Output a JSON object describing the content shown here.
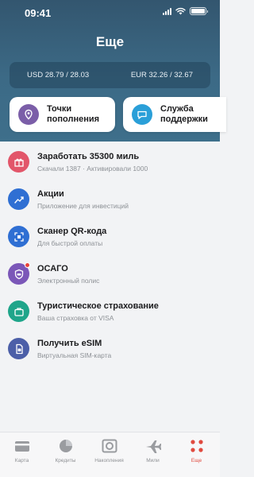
{
  "status_bar": {
    "time": "09:41"
  },
  "header": {
    "title": "Еще"
  },
  "rates": {
    "usd": "USD 28.79 / 28.03",
    "eur": "EUR 32.26 / 32.67"
  },
  "cards": [
    {
      "label": "Точки\nпополнения",
      "icon": "map-pin-icon",
      "color": "#7b5ea8"
    },
    {
      "label": "Служба\nподдержки",
      "icon": "chat-bubble-icon",
      "color": "#2a9fd8"
    }
  ],
  "menu": [
    {
      "title": "Заработать 35300 миль",
      "subtitle": "Скачали 1387 · Активировали 1000",
      "icon": "gift-icon",
      "color": "#e2566a"
    },
    {
      "title": "Акции",
      "subtitle": "Приложение для инвестиций",
      "icon": "chart-icon",
      "color": "#2f6fd3"
    },
    {
      "title": "Сканер QR-кода",
      "subtitle": "Для быстрой оплаты",
      "icon": "qr-scan-icon",
      "color": "#2f6fd3"
    },
    {
      "title": "ОСАГО",
      "subtitle": "Электронный полис",
      "icon": "car-shield-icon",
      "color": "#7b57b8"
    },
    {
      "title": "Туристическое страхование",
      "subtitle": "Ваша страховка от VISA",
      "icon": "suitcase-icon",
      "color": "#1fa58a"
    },
    {
      "title": "Получить eSIM",
      "subtitle": "Виртуальная SIM-карта",
      "icon": "sim-card-icon",
      "color": "#4c5fa8"
    }
  ],
  "tabs": [
    {
      "label": "Карта",
      "icon": "card-icon"
    },
    {
      "label": "Кредиты",
      "icon": "pie-chart-icon"
    },
    {
      "label": "Накопления",
      "icon": "savings-icon"
    },
    {
      "label": "Мили",
      "icon": "plane-icon"
    },
    {
      "label": "Еще",
      "icon": "more-dots-icon",
      "active": true
    }
  ],
  "colors": {
    "header": "#3c6a86",
    "accent": "#e04a3f"
  }
}
